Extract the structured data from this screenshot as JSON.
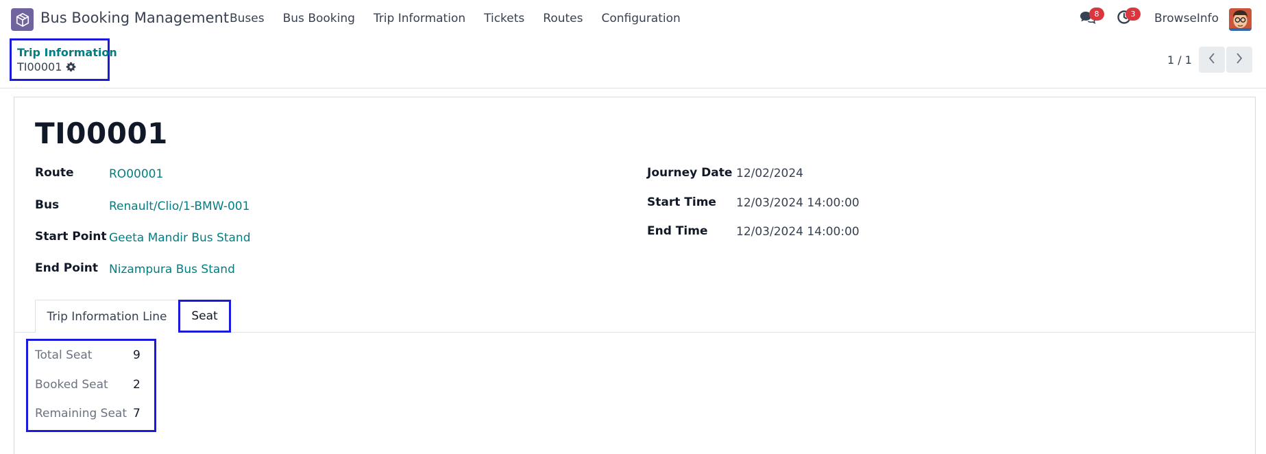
{
  "navbar": {
    "app_name": "Bus Booking Management",
    "menu": [
      "Buses",
      "Bus Booking",
      "Trip Information",
      "Tickets",
      "Routes",
      "Configuration"
    ],
    "messages_count": "8",
    "activities_count": "3",
    "user_name": "BrowseInfo"
  },
  "breadcrumb": {
    "parent": "Trip Information",
    "current": "TI00001"
  },
  "pager": {
    "text": "1 / 1"
  },
  "record": {
    "title": "TI00001",
    "left_fields": [
      {
        "label": "Route",
        "value": "RO00001"
      },
      {
        "label": "Bus",
        "value": "Renault/Clio/1-BMW-001"
      },
      {
        "label": "Start Point",
        "value": "Geeta Mandir Bus Stand"
      },
      {
        "label": "End Point",
        "value": "Nizampura Bus Stand"
      }
    ],
    "right_fields": [
      {
        "label": "Journey Date",
        "value": "12/02/2024"
      },
      {
        "label": "Start Time",
        "value": "12/03/2024 14:00:00"
      },
      {
        "label": "End Time",
        "value": "12/03/2024 14:00:00"
      }
    ]
  },
  "tabs": [
    {
      "label": "Trip Information Line",
      "active": false
    },
    {
      "label": "Seat",
      "active": true
    }
  ],
  "seat": [
    {
      "label": "Total Seat",
      "value": "9"
    },
    {
      "label": "Booked Seat",
      "value": "2"
    },
    {
      "label": "Remaining Seat",
      "value": "7"
    }
  ],
  "colors": {
    "accent": "#017e84",
    "highlight_box": "#1a1adb",
    "badge": "#d9363e",
    "app_icon": "#71639e"
  }
}
